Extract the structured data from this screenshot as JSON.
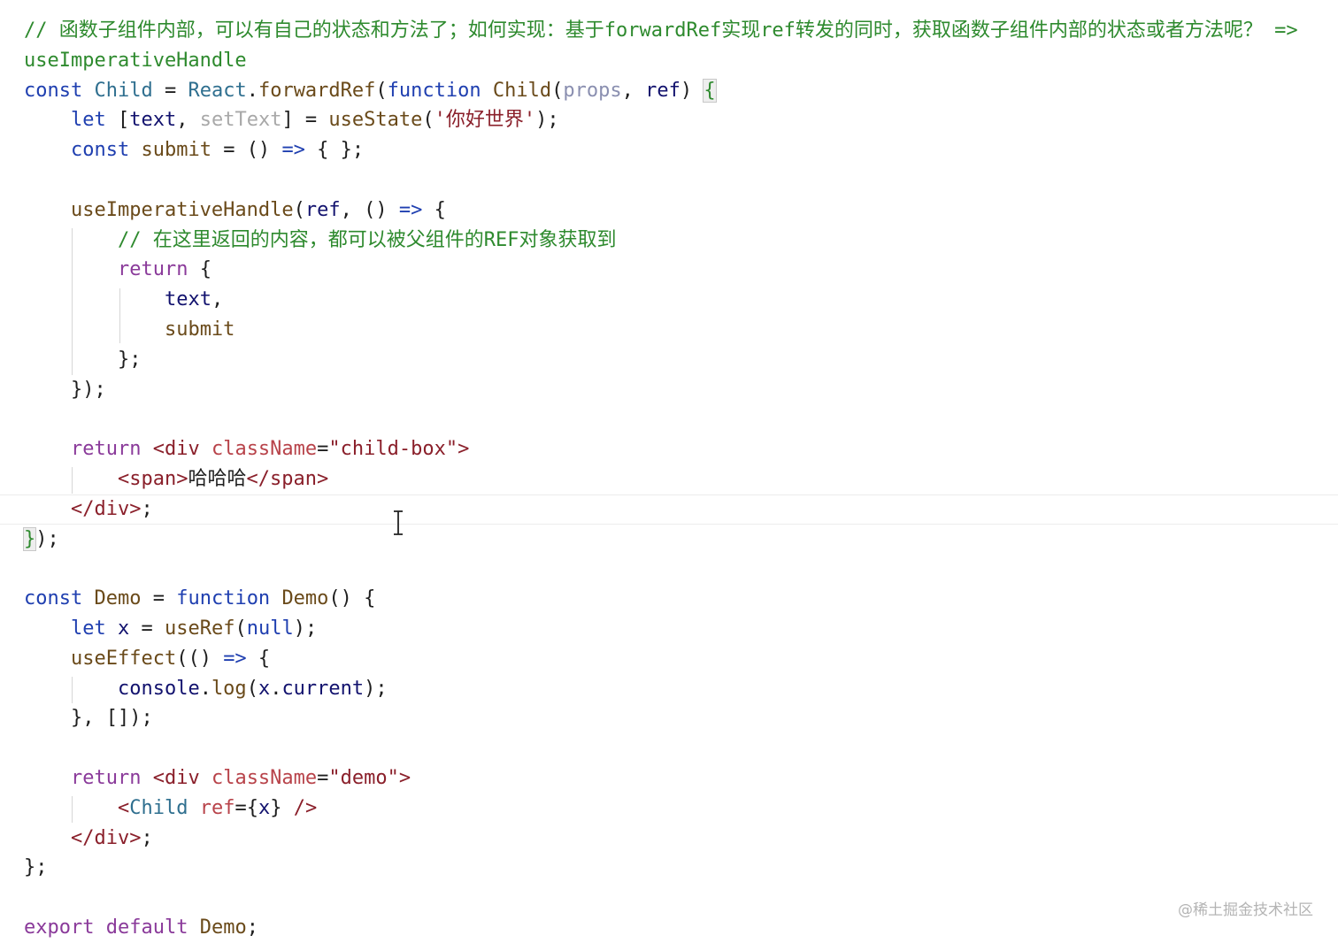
{
  "editor": {
    "lines": [
      [
        {
          "t": "// 函数子组件内部，可以有自己的状态和方法了；如何实现：基于forwardRef实现ref转发的同时，获取函数子组件内部的状态或者方法呢？ =>",
          "c": "cm"
        }
      ],
      [
        {
          "t": "useImperativeHandle",
          "c": "cm"
        }
      ],
      [
        {
          "t": "const",
          "c": "kw"
        },
        {
          "t": " ",
          "c": "op"
        },
        {
          "t": "Child",
          "c": "ty"
        },
        {
          "t": " = ",
          "c": "op"
        },
        {
          "t": "React",
          "c": "ty"
        },
        {
          "t": ".",
          "c": "op"
        },
        {
          "t": "forwardRef",
          "c": "fn"
        },
        {
          "t": "(",
          "c": "op"
        },
        {
          "t": "function",
          "c": "kw"
        },
        {
          "t": " ",
          "c": "op"
        },
        {
          "t": "Child",
          "c": "fn"
        },
        {
          "t": "(",
          "c": "op"
        },
        {
          "t": "props",
          "c": "pm"
        },
        {
          "t": ", ",
          "c": "op"
        },
        {
          "t": "ref",
          "c": "var"
        },
        {
          "t": ") ",
          "c": "op"
        },
        {
          "t": "{",
          "c": "brk"
        }
      ],
      [
        {
          "t": "    ",
          "c": "op"
        },
        {
          "t": "let",
          "c": "kw"
        },
        {
          "t": " [",
          "c": "op"
        },
        {
          "t": "text",
          "c": "var"
        },
        {
          "t": ", ",
          "c": "op"
        },
        {
          "t": "setText",
          "c": "dim"
        },
        {
          "t": "] = ",
          "c": "op"
        },
        {
          "t": "useState",
          "c": "fn"
        },
        {
          "t": "(",
          "c": "op"
        },
        {
          "t": "'你好世界'",
          "c": "str"
        },
        {
          "t": ");",
          "c": "op"
        }
      ],
      [
        {
          "t": "    ",
          "c": "op"
        },
        {
          "t": "const",
          "c": "kw"
        },
        {
          "t": " ",
          "c": "op"
        },
        {
          "t": "submit",
          "c": "fn"
        },
        {
          "t": " = () ",
          "c": "op"
        },
        {
          "t": "=>",
          "c": "kw"
        },
        {
          "t": " { };",
          "c": "op"
        }
      ],
      [
        {
          "t": "",
          "c": "op"
        }
      ],
      [
        {
          "t": "    ",
          "c": "op"
        },
        {
          "t": "useImperativeHandle",
          "c": "fn"
        },
        {
          "t": "(",
          "c": "op"
        },
        {
          "t": "ref",
          "c": "var"
        },
        {
          "t": ", () ",
          "c": "op"
        },
        {
          "t": "=>",
          "c": "kw"
        },
        {
          "t": " {",
          "c": "op"
        }
      ],
      [
        {
          "t": "        ",
          "c": "op"
        },
        {
          "t": "// 在这里返回的内容，都可以被父组件的REF对象获取到",
          "c": "cm"
        }
      ],
      [
        {
          "t": "        ",
          "c": "op"
        },
        {
          "t": "return",
          "c": "ret"
        },
        {
          "t": " {",
          "c": "op"
        }
      ],
      [
        {
          "t": "            ",
          "c": "op"
        },
        {
          "t": "text",
          "c": "var"
        },
        {
          "t": ",",
          "c": "op"
        }
      ],
      [
        {
          "t": "            ",
          "c": "op"
        },
        {
          "t": "submit",
          "c": "fn"
        }
      ],
      [
        {
          "t": "        };",
          "c": "op"
        }
      ],
      [
        {
          "t": "    });",
          "c": "op"
        }
      ],
      [
        {
          "t": "",
          "c": "op"
        }
      ],
      [
        {
          "t": "    ",
          "c": "op"
        },
        {
          "t": "return",
          "c": "ret"
        },
        {
          "t": " ",
          "c": "op"
        },
        {
          "t": "<div",
          "c": "tag"
        },
        {
          "t": " ",
          "c": "op"
        },
        {
          "t": "className",
          "c": "jsx"
        },
        {
          "t": "=",
          "c": "op"
        },
        {
          "t": "\"child-box\"",
          "c": "str"
        },
        {
          "t": ">",
          "c": "tag"
        }
      ],
      [
        {
          "t": "        ",
          "c": "op"
        },
        {
          "t": "<span>",
          "c": "tag"
        },
        {
          "t": "哈哈哈",
          "c": "op"
        },
        {
          "t": "</span>",
          "c": "tag"
        }
      ],
      [
        {
          "t": "    ",
          "c": "op"
        },
        {
          "t": "</div>",
          "c": "tag"
        },
        {
          "t": ";",
          "c": "op"
        }
      ],
      [
        {
          "t": "}",
          "c": "brk"
        },
        {
          "t": ");",
          "c": "op"
        }
      ],
      [
        {
          "t": "",
          "c": "op"
        }
      ],
      [
        {
          "t": "const",
          "c": "kw"
        },
        {
          "t": " ",
          "c": "op"
        },
        {
          "t": "Demo",
          "c": "fn"
        },
        {
          "t": " = ",
          "c": "op"
        },
        {
          "t": "function",
          "c": "kw"
        },
        {
          "t": " ",
          "c": "op"
        },
        {
          "t": "Demo",
          "c": "fn"
        },
        {
          "t": "() {",
          "c": "op"
        }
      ],
      [
        {
          "t": "    ",
          "c": "op"
        },
        {
          "t": "let",
          "c": "kw"
        },
        {
          "t": " ",
          "c": "op"
        },
        {
          "t": "x",
          "c": "var"
        },
        {
          "t": " = ",
          "c": "op"
        },
        {
          "t": "useRef",
          "c": "fn"
        },
        {
          "t": "(",
          "c": "op"
        },
        {
          "t": "null",
          "c": "kw"
        },
        {
          "t": ");",
          "c": "op"
        }
      ],
      [
        {
          "t": "    ",
          "c": "op"
        },
        {
          "t": "useEffect",
          "c": "fn"
        },
        {
          "t": "(() ",
          "c": "op"
        },
        {
          "t": "=>",
          "c": "kw"
        },
        {
          "t": " {",
          "c": "op"
        }
      ],
      [
        {
          "t": "        ",
          "c": "op"
        },
        {
          "t": "console",
          "c": "var"
        },
        {
          "t": ".",
          "c": "op"
        },
        {
          "t": "log",
          "c": "fn"
        },
        {
          "t": "(",
          "c": "op"
        },
        {
          "t": "x",
          "c": "var"
        },
        {
          "t": ".",
          "c": "op"
        },
        {
          "t": "current",
          "c": "var"
        },
        {
          "t": ");",
          "c": "op"
        }
      ],
      [
        {
          "t": "    }, []);",
          "c": "op"
        }
      ],
      [
        {
          "t": "",
          "c": "op"
        }
      ],
      [
        {
          "t": "    ",
          "c": "op"
        },
        {
          "t": "return",
          "c": "ret"
        },
        {
          "t": " ",
          "c": "op"
        },
        {
          "t": "<div",
          "c": "tag"
        },
        {
          "t": " ",
          "c": "op"
        },
        {
          "t": "className",
          "c": "jsx"
        },
        {
          "t": "=",
          "c": "op"
        },
        {
          "t": "\"demo\"",
          "c": "str"
        },
        {
          "t": ">",
          "c": "tag"
        }
      ],
      [
        {
          "t": "        ",
          "c": "op"
        },
        {
          "t": "<",
          "c": "tag"
        },
        {
          "t": "Child",
          "c": "ty"
        },
        {
          "t": " ",
          "c": "op"
        },
        {
          "t": "ref",
          "c": "jsx"
        },
        {
          "t": "=",
          "c": "op"
        },
        {
          "t": "{",
          "c": "op"
        },
        {
          "t": "x",
          "c": "var"
        },
        {
          "t": "}",
          "c": "op"
        },
        {
          "t": " />",
          "c": "tag"
        }
      ],
      [
        {
          "t": "    ",
          "c": "op"
        },
        {
          "t": "</div>",
          "c": "tag"
        },
        {
          "t": ";",
          "c": "op"
        }
      ],
      [
        {
          "t": "};",
          "c": "op"
        }
      ],
      [
        {
          "t": "",
          "c": "op"
        }
      ],
      [
        {
          "t": "export",
          "c": "ret"
        },
        {
          "t": " ",
          "c": "op"
        },
        {
          "t": "default",
          "c": "ret"
        },
        {
          "t": " ",
          "c": "op"
        },
        {
          "t": "Demo",
          "c": "fn"
        },
        {
          "t": ";",
          "c": "op"
        }
      ]
    ],
    "current_line": 16
  },
  "watermark": "@稀土掘金技术社区",
  "colors": {
    "comment": "#2e8a2e",
    "keyword": "#1f3fb0",
    "string": "#8a1f2a",
    "return_keyword": "#8a3a9a",
    "background": "#ffffff"
  }
}
